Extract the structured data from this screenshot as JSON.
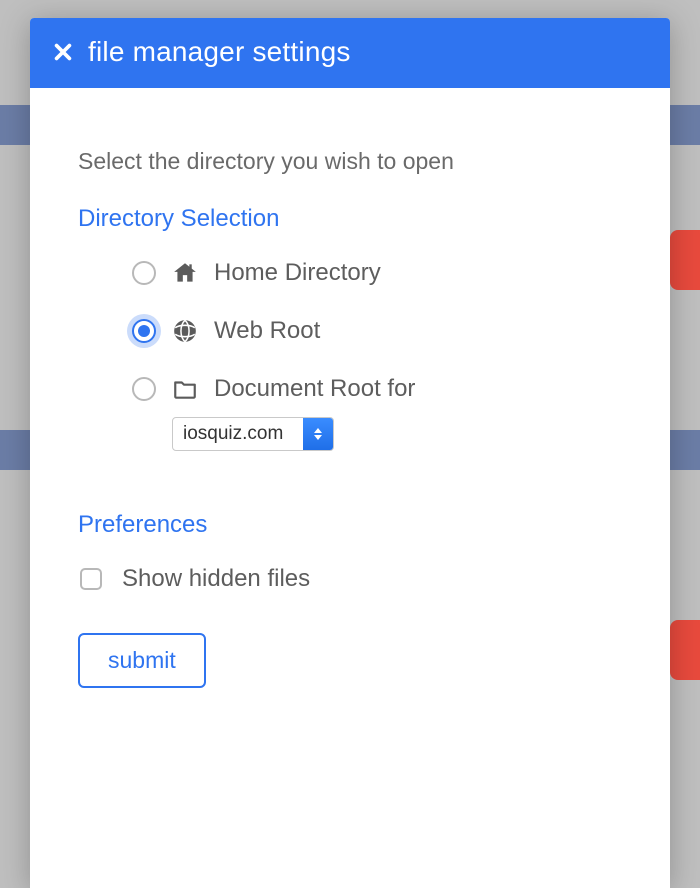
{
  "modal": {
    "title": "file manager settings",
    "instruction": "Select the directory you wish to open",
    "directory_section": {
      "title": "Directory Selection",
      "options": [
        {
          "label": "Home Directory",
          "selected": false
        },
        {
          "label": "Web Root",
          "selected": true
        },
        {
          "label": "Document Root for",
          "selected": false
        }
      ],
      "domain_select": {
        "value": "iosquiz.com"
      }
    },
    "preferences_section": {
      "title": "Preferences",
      "show_hidden_label": "Show hidden files",
      "show_hidden_checked": false
    },
    "submit_label": "submit"
  }
}
